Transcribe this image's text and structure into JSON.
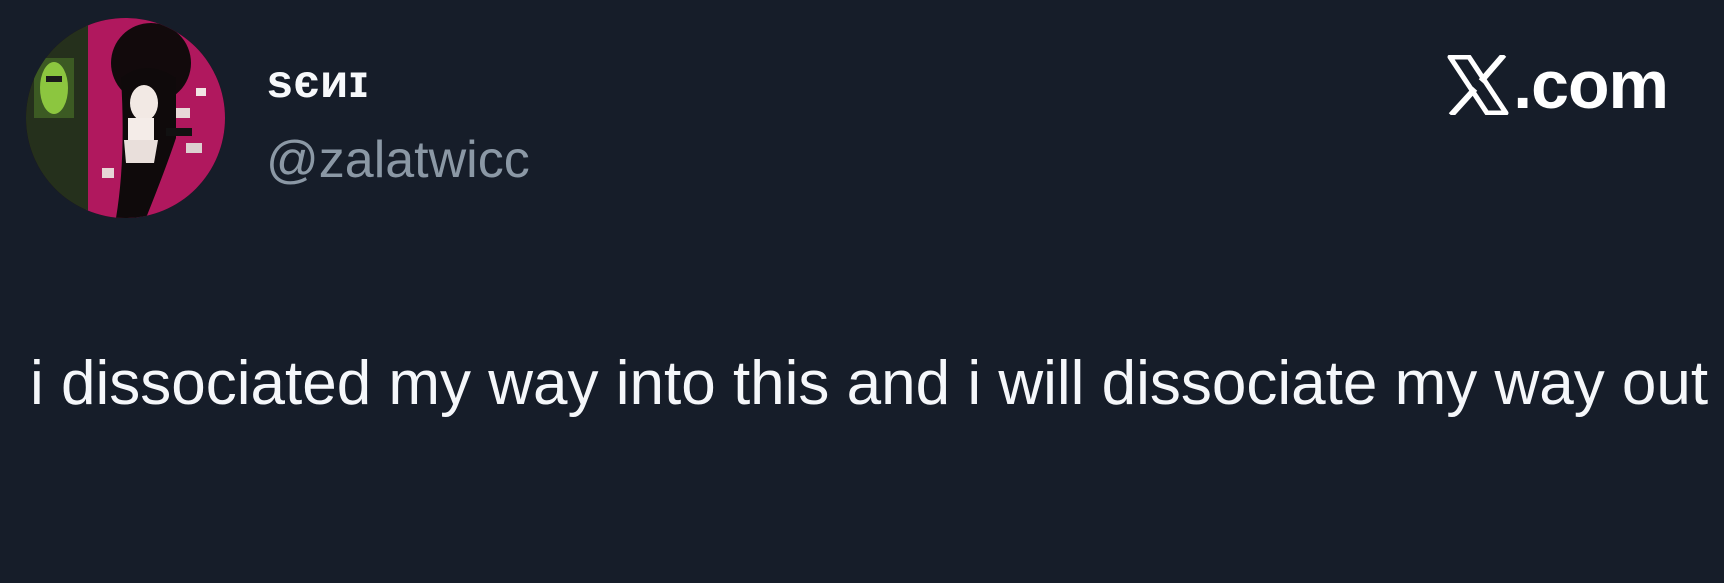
{
  "author": {
    "display_name": "sєиɪ",
    "handle": "@zalatwicc"
  },
  "brand": {
    "label": ".com",
    "icon": "x-logo-icon"
  },
  "tweet": {
    "text": "i dissociated my way into this and i will dissociate my way out"
  },
  "colors": {
    "background": "#161d29",
    "text_primary": "#f5f7fa",
    "text_secondary": "#8b98a5",
    "avatar_accent": "#b0185e"
  }
}
